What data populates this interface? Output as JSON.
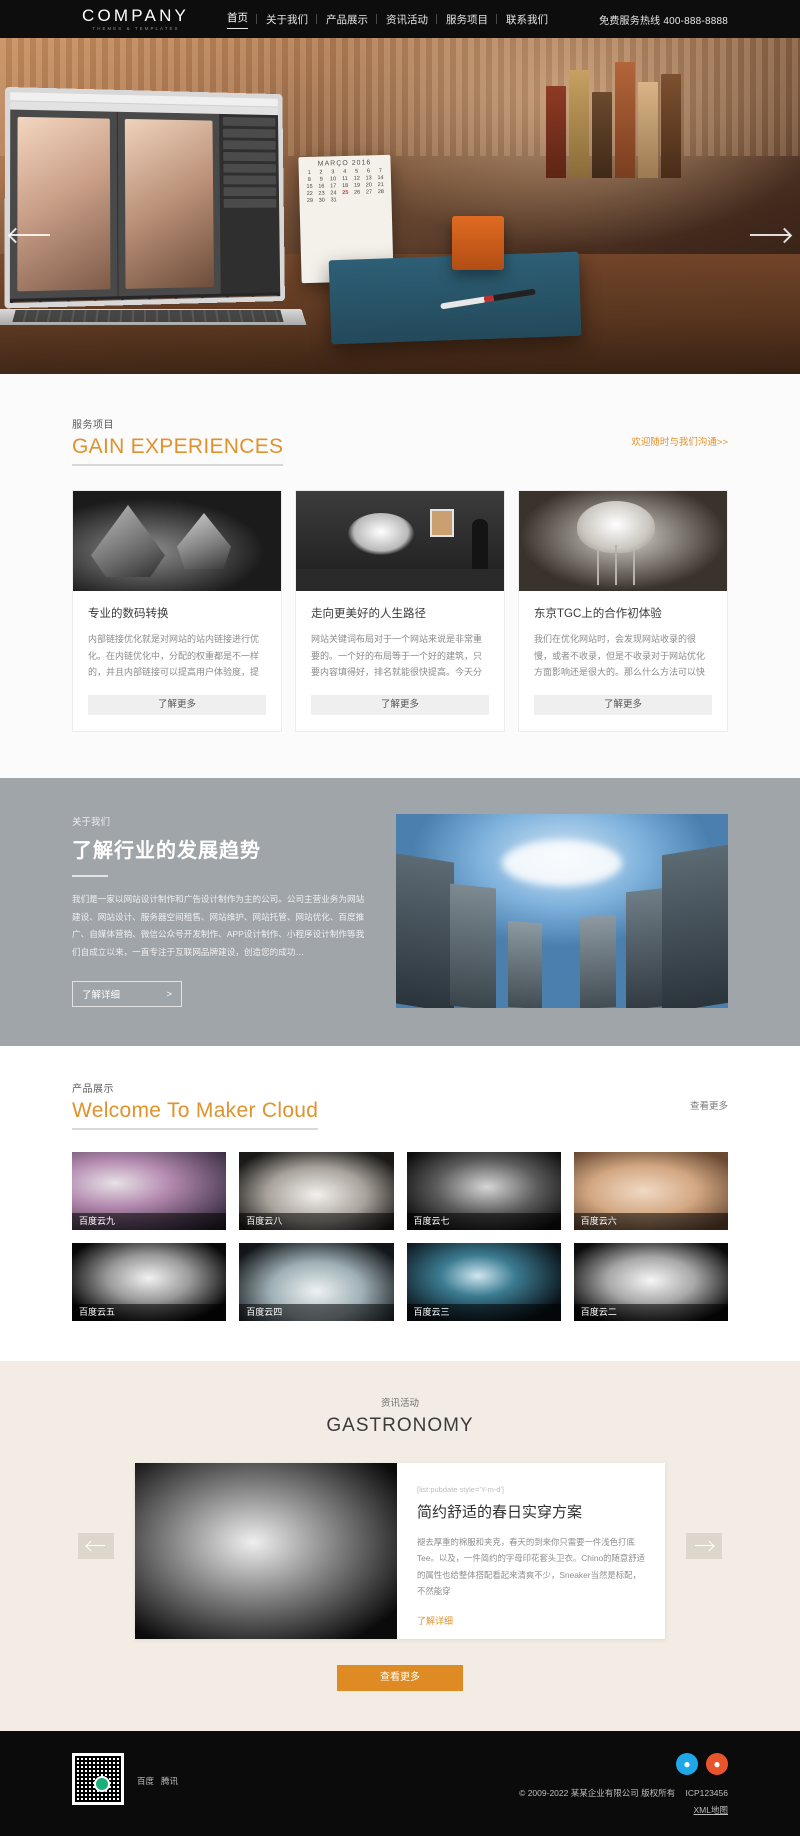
{
  "header": {
    "brand_name": "COMPANY",
    "brand_tagline": "THEMES & TEMPLATES",
    "nav": [
      {
        "label": "首页",
        "active": true
      },
      {
        "label": "关于我们",
        "active": false
      },
      {
        "label": "产品展示",
        "active": false
      },
      {
        "label": "资讯活动",
        "active": false
      },
      {
        "label": "服务项目",
        "active": false
      },
      {
        "label": "联系我们",
        "active": false
      }
    ],
    "hotline": "免费服务热线 400-888-8888"
  },
  "hero": {
    "prev_label": "上一张",
    "next_label": "下一张",
    "calendar_month": "MARÇO 2016",
    "calendar_days": [
      "1",
      "2",
      "3",
      "4",
      "5",
      "6",
      "7",
      "8",
      "9",
      "10",
      "11",
      "12",
      "13",
      "14",
      "15",
      "16",
      "17",
      "18",
      "19",
      "20",
      "21",
      "22",
      "23",
      "24",
      "25",
      "26",
      "27",
      "28",
      "29",
      "30",
      "31"
    ],
    "calendar_highlight": "25"
  },
  "services": {
    "kicker": "服务项目",
    "title": "GAIN EXPERIENCES",
    "more_label": "欢迎随时与我们沟通>>",
    "cards": [
      {
        "title": "专业的数码转换",
        "desc": "内部链接优化就是对网站的站内链接进行优化。在内链优化中，分配的权重都是不一样的，并且内部链接可以提高用户体验度，提升访问…",
        "button": "了解更多"
      },
      {
        "title": "走向更美好的人生路径",
        "desc": "网站关键词布局对于一个网站来说是非常重要的。一个好的布局等于一个好的建筑，只要内容填得好，排名就能很快提高。今天分析这个…",
        "button": "了解更多"
      },
      {
        "title": "东京TGC上的合作初体验",
        "desc": "我们在优化网站时，会发现网站收录的很慢，或者不收录，但是不收录对于网站优化方面影响还是很大的。那么什么方法可以快速提高网…",
        "button": "了解更多"
      }
    ]
  },
  "about": {
    "kicker": "关于我们",
    "heading": "了解行业的发展趋势",
    "paragraph": "我们是一家以网站设计制作和广告设计制作为主的公司。公司主营业务为网站建设、网站设计、服务器空间租售、网站维护、网站托管、网站优化、百度推广、自媒体营销、微信公众号开发制作、APP设计制作、小程序设计制作等我们自成立以来，一直专注于互联网品牌建设，创造您的成功…",
    "button": "了解详细",
    "button_arrow": ">"
  },
  "products": {
    "kicker": "产品展示",
    "title": "Welcome To Maker Cloud",
    "more_label": "查看更多",
    "items": [
      {
        "caption": "百度云九"
      },
      {
        "caption": "百度云八"
      },
      {
        "caption": "百度云七"
      },
      {
        "caption": "百度云六"
      },
      {
        "caption": "百度云五"
      },
      {
        "caption": "百度云四"
      },
      {
        "caption": "百度云三"
      },
      {
        "caption": "百度云二"
      }
    ]
  },
  "news": {
    "kicker": "资讯活动",
    "title": "GASTRONOMY",
    "prev_label": "上一条",
    "next_label": "下一条",
    "article": {
      "date": "[list:pubdate style='Y-m-d']",
      "title": "简约舒适的春日实穿方案",
      "desc": "褪去厚重的棉服和夹克，春天的到来你只需要一件浅色打底Tee。以及，一件简约的字母印花套头卫衣。Chino的随意舒适的属性也给整体搭配看起来清爽不少，Sneaker当然是标配，不然能穿",
      "link": "了解详细"
    },
    "more_button": "查看更多"
  },
  "footer": {
    "links": [
      "百度",
      "腾讯"
    ],
    "socials": [
      {
        "name": "qq-icon",
        "glyph": "●"
      },
      {
        "name": "weibo-icon",
        "glyph": "●"
      }
    ],
    "copyright": "© 2009-2022 某某企业有限公司 版权所有",
    "icp": "ICP123456",
    "sitemap": "XML地图"
  }
}
